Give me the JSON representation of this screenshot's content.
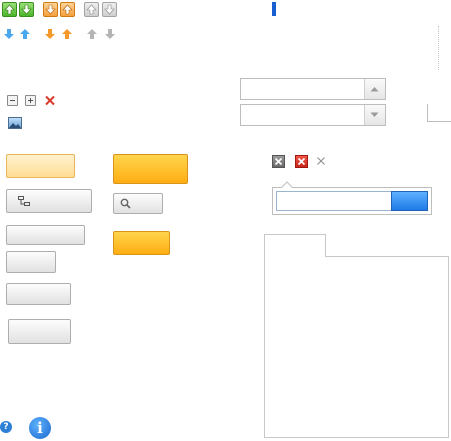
{
  "icons": {
    "row1": [
      "arrow-up-green-icon",
      "arrow-down-green-icon",
      "arrow-down-orange-icon",
      "arrow-up-orange-icon",
      "arrow-up-grey-icon",
      "arrow-down-grey-icon"
    ],
    "row2": [
      "arrow-down-blue-icon",
      "arrow-up-blue-icon",
      "arrow-down-orange-small-icon",
      "arrow-up-orange-small-icon",
      "arrow-up-grey-small-icon",
      "arrow-down-grey-small-icon"
    ],
    "tool": [
      "collapse-icon",
      "expand-icon",
      "delete-icon",
      "image-icon"
    ],
    "close": [
      "close-grey-icon",
      "close-red-icon",
      "close-plain-icon"
    ],
    "bottom": [
      "help-icon",
      "info-icon"
    ]
  },
  "colors": {
    "green": "#4cb52a",
    "orange": "#f5a03c",
    "blue": "#3a8fe0",
    "red": "#d93a2b",
    "yellow": "#ffbb22",
    "accent_bar": "#1a5fd1"
  },
  "combo_upper": {
    "value": ""
  },
  "combo_lower": {
    "value": ""
  },
  "search": {
    "value": ""
  },
  "tab": {
    "label": ""
  }
}
